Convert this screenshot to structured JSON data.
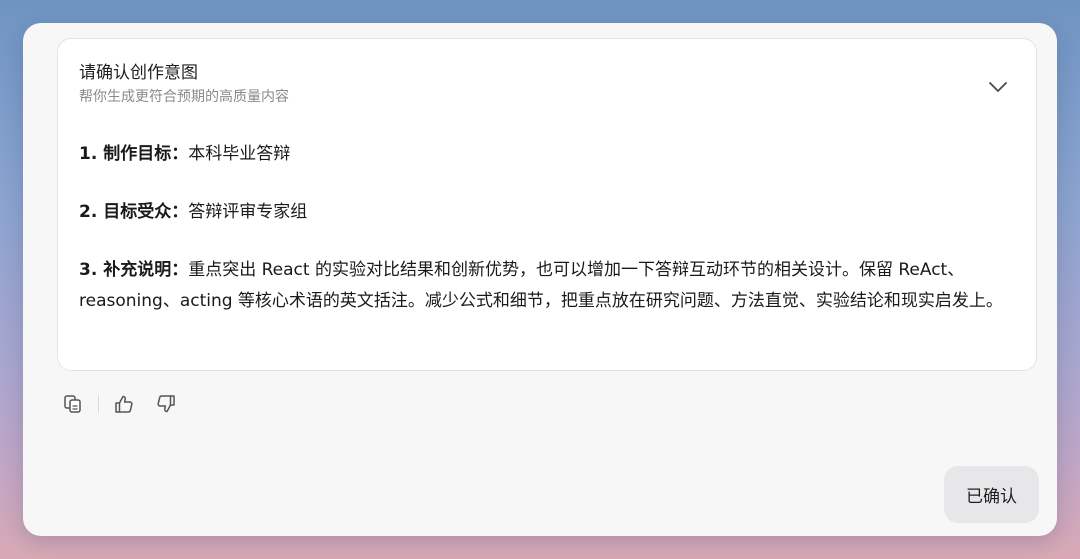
{
  "card": {
    "title": "请确认创作意图",
    "subtitle": "帮你生成更符合预期的高质量内容",
    "items": [
      {
        "label": "1. 制作目标：",
        "text": "本科毕业答辩"
      },
      {
        "label": "2. 目标受众：",
        "text": "答辩评审专家组"
      },
      {
        "label": "3. 补充说明：",
        "text": "重点突出 React 的实验对比结果和创新优势，也可以增加一下答辩互动环节的相关设计。保留 ReAct、reasoning、acting 等核心术语的英文括注。减少公式和细节，把重点放在研究问题、方法直觉、实验结论和现实启发上。"
      }
    ],
    "toggle_icon": "chevron-down-icon"
  },
  "actions": {
    "icons": [
      "copy-icon",
      "thumbs-up-icon",
      "thumbs-down-icon"
    ]
  },
  "confirm_button": {
    "label": "已确认"
  },
  "colors": {
    "window_bg": "#f7f7f8",
    "card_bg": "#ffffff",
    "button_bg": "#e7e7e9",
    "text_primary": "#1a1a1a",
    "text_secondary": "#8a8a8a"
  }
}
